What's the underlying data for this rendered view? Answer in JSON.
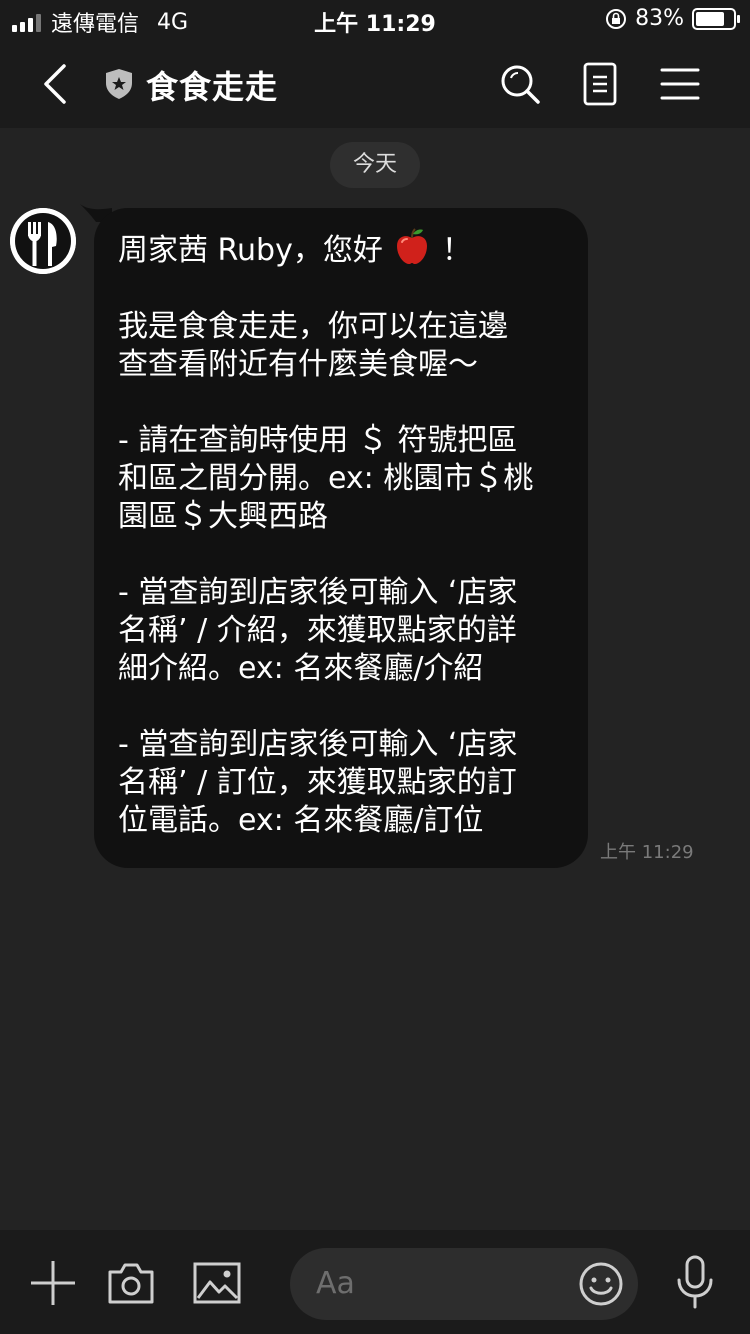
{
  "status_bar": {
    "carrier": "遠傳電信",
    "network": "4G",
    "time": "上午 11:29",
    "battery": "83%",
    "battery_level": 0.83
  },
  "header": {
    "title": "食食走走",
    "icons": [
      "back-chevron-icon",
      "official-shield-icon",
      "search-icon",
      "notes-icon",
      "menu-icon"
    ]
  },
  "chat": {
    "date_label": "今天",
    "messages": [
      {
        "sender": "食食走走",
        "greeting": "周家茜 Ruby，您好 ",
        "greeting_end": " ！",
        "body": "\n\n我是食食走走，你可以在這邊\n查查看附近有什麼美食喔～\n\n- 請在查詢時使用 ＄ 符號把區\n和區之間分開。ex: 桃園市＄桃\n園區＄大興西路\n\n- 當查詢到店家後可輸入 ‘店家\n名稱’ / 介紹，來獲取點家的詳\n細介紹。ex: 名來餐廳/介紹\n\n- 當查詢到店家後可輸入 ‘店家\n名稱’ / 訂位，來獲取點家的訂\n位電話。ex: 名來餐廳/訂位",
        "time": "上午 11:29"
      }
    ]
  },
  "input_bar": {
    "placeholder": "Aa",
    "icons": [
      "plus-icon",
      "camera-icon",
      "image-icon",
      "emoji-icon",
      "microphone-icon"
    ]
  },
  "colors": {
    "background": "#232323",
    "bars": "#1b1b1b",
    "bubble": "#111111",
    "text": "#ffffff"
  }
}
